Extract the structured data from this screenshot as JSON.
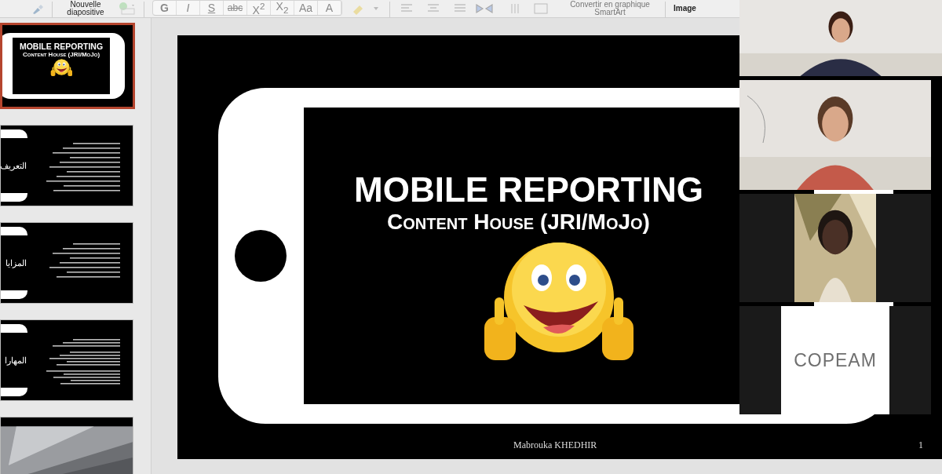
{
  "toolbar": {
    "new_slide_label": "Nouvelle diapositive",
    "format_buttons": [
      {
        "label": "G",
        "kind": "bold"
      },
      {
        "label": "I",
        "kind": "italic"
      },
      {
        "label": "S",
        "kind": "underline"
      },
      {
        "label": "abc",
        "kind": "strike"
      },
      {
        "label": "X$^{2}$",
        "kind": "plain"
      },
      {
        "label": "X$_{2}$",
        "kind": "plain"
      },
      {
        "label": "Aa",
        "kind": "plain"
      },
      {
        "label": "A",
        "kind": "plain"
      }
    ],
    "smartart_label": "Convertir en graphique SmartArt",
    "image_label": "Image"
  },
  "slides": [
    {
      "kind": "title",
      "selected": true,
      "title": "MOBILE REPORTING",
      "subtitle": "Content House (JRI/MoJo)"
    },
    {
      "kind": "text",
      "selected": false,
      "title": "التعريف"
    },
    {
      "kind": "bullets",
      "selected": false,
      "title": "المزايا"
    },
    {
      "kind": "dense",
      "selected": false,
      "title": "المهارا"
    },
    {
      "kind": "picture",
      "selected": false
    }
  ],
  "slide": {
    "title": "MOBILE REPORTING",
    "subtitle": "Content House (JRI/MoJo)",
    "footer": "Mabrouka KHEDHIR",
    "number": "1"
  },
  "participants": [
    {
      "kind": "picture"
    },
    {
      "kind": "picture"
    },
    {
      "kind": "inset"
    },
    {
      "kind": "logo",
      "logo_text": "COPEAM"
    }
  ]
}
